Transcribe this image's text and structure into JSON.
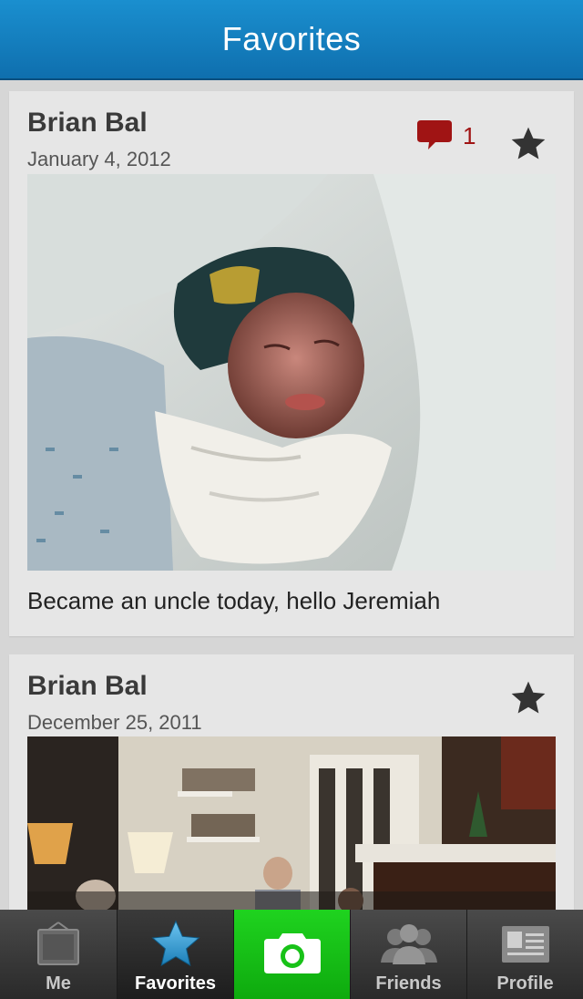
{
  "header": {
    "title": "Favorites"
  },
  "posts": [
    {
      "author": "Brian Bal",
      "date": "January  4, 2012",
      "comment_count": "1",
      "caption": "Became an uncle today, hello Jeremiah",
      "favorited": true
    },
    {
      "author": "Brian Bal",
      "date": "December 25, 2011",
      "favorited": true
    }
  ],
  "tabbar": {
    "tabs": [
      {
        "label": "Me",
        "icon": "me-icon"
      },
      {
        "label": "Favorites",
        "icon": "star-icon",
        "active": true
      },
      {
        "label": "",
        "icon": "camera-icon"
      },
      {
        "label": "Friends",
        "icon": "friends-icon"
      },
      {
        "label": "Profile",
        "icon": "profile-card-icon"
      }
    ]
  },
  "colors": {
    "header": "#1a8fcf",
    "comment": "#a01414",
    "camera_tab": "#18c218",
    "card": "#e6e6e6"
  }
}
